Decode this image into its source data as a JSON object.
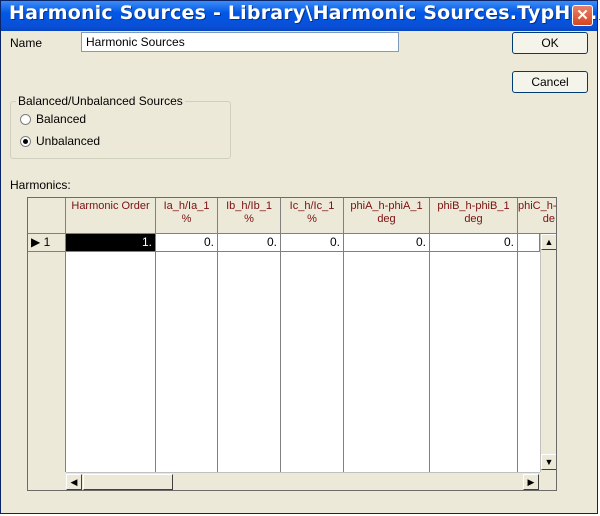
{
  "window": {
    "title": "Harmonic Sources - Library\\Harmonic Sources.TypHm…",
    "close_glyph": "✕"
  },
  "name_field": {
    "label": "Name",
    "value": "Harmonic Sources"
  },
  "buttons": {
    "ok": "OK",
    "cancel": "Cancel"
  },
  "balance_group": {
    "title": "Balanced/Unbalanced Sources",
    "options": [
      {
        "label": "Balanced",
        "checked": false
      },
      {
        "label": "Unbalanced",
        "checked": true
      }
    ]
  },
  "harmonics": {
    "label": "Harmonics:",
    "columns": [
      {
        "line1": "Harmonic Order",
        "line2": ""
      },
      {
        "line1": "Ia_h/Ia_1",
        "line2": "%"
      },
      {
        "line1": "Ib_h/Ib_1",
        "line2": "%"
      },
      {
        "line1": "Ic_h/Ic_1",
        "line2": "%"
      },
      {
        "line1": "phiA_h-phiA_1",
        "line2": "deg"
      },
      {
        "line1": "phiB_h-phiB_1",
        "line2": "deg"
      },
      {
        "line1": "phiC_h-",
        "line2": "de"
      }
    ],
    "rows": [
      {
        "index": "1",
        "marker": "▶",
        "values": [
          "1.",
          "0.",
          "0.",
          "0.",
          "0.",
          "0.",
          ""
        ]
      }
    ]
  },
  "scroll_glyphs": {
    "up": "▲",
    "down": "▼",
    "left": "◀",
    "right": "▶"
  }
}
